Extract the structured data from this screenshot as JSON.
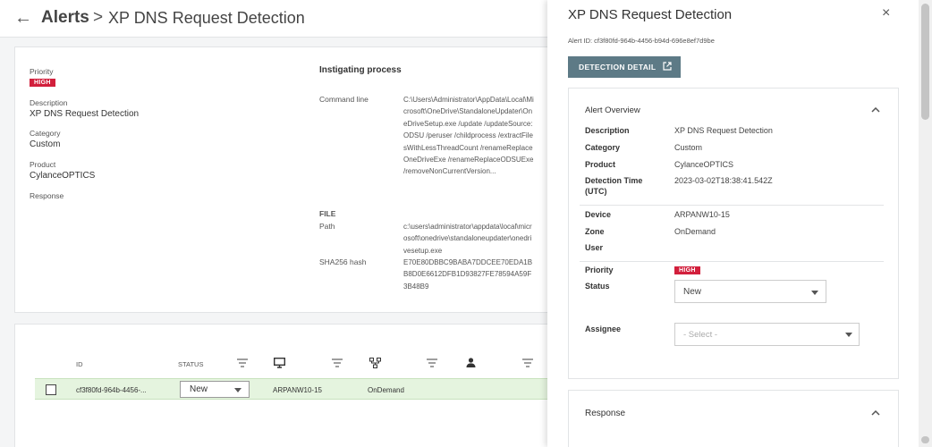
{
  "header": {
    "back_glyph": "←",
    "breadcrumb": "Alerts",
    "separator": ">",
    "title": "XP DNS Request Detection"
  },
  "details": {
    "priority_label": "Priority",
    "priority_value": "HIGH",
    "description_label": "Description",
    "description_value": "XP DNS Request Detection",
    "category_label": "Category",
    "category_value": "Custom",
    "product_label": "Product",
    "product_value": "CylanceOPTICS",
    "response_label": "Response"
  },
  "process": {
    "section_title": "Instigating process",
    "command_line_label": "Command line",
    "command_line_value": "C:\\Users\\Administrator\\AppData\\Local\\Microsoft\\OneDrive\\StandaloneUpdater\\OneDriveSetup.exe /update /updateSource:ODSU /peruser /childprocess /extractFilesWithLessThreadCount /renameReplaceOneDriveExe /renameReplaceODSUExe /removeNonCurrentVersion...",
    "file_label": "FILE",
    "path_label": "Path",
    "path_value": "c:\\users\\administrator\\appdata\\local\\microsoft\\onedrive\\standaloneupdater\\onedrivesetup.exe",
    "sha_label": "SHA256 hash",
    "sha_value": "E70E80DBBC9BABA7DDCEE70EDA1BB8D0E6612DFB1D93827FE78594A59F3B48B9"
  },
  "table": {
    "columns": {
      "id": "ID",
      "status": "STATUS"
    },
    "column_icons": [
      "filter-icon",
      "monitor-icon",
      "network-icon",
      "user-icon"
    ],
    "row": {
      "id": "cf3f80fd-964b-4456-...",
      "status": "New",
      "device": "ARPANW10-15",
      "zone": "OnDemand"
    }
  },
  "panel": {
    "title": "XP DNS Request Detection",
    "close_glyph": "×",
    "alert_id": "Alert ID: cf3f80fd-964b-4456-b94d-696e8ef7d9be",
    "detail_button": "DETECTION DETAIL",
    "overview": {
      "title": "Alert Overview",
      "description_label": "Description",
      "description_value": "XP DNS Request Detection",
      "category_label": "Category",
      "category_value": "Custom",
      "product_label": "Product",
      "product_value": "CylanceOPTICS",
      "detection_time_label": "Detection Time",
      "detection_time_sublabel": "(UTC)",
      "detection_time_value": "2023-03-02T18:38:41.542Z",
      "device_label": "Device",
      "device_value": "ARPANW10-15",
      "zone_label": "Zone",
      "zone_value": "OnDemand",
      "user_label": "User",
      "priority_label": "Priority",
      "priority_value": "HIGH",
      "status_label": "Status",
      "status_value": "New",
      "assignee_label": "Assignee",
      "assignee_placeholder": "- Select -"
    },
    "response_title": "Response"
  },
  "colors": {
    "high_badge": "#d21f3c",
    "selected_row": "#e5f4df",
    "detail_button": "#5d7a86"
  }
}
